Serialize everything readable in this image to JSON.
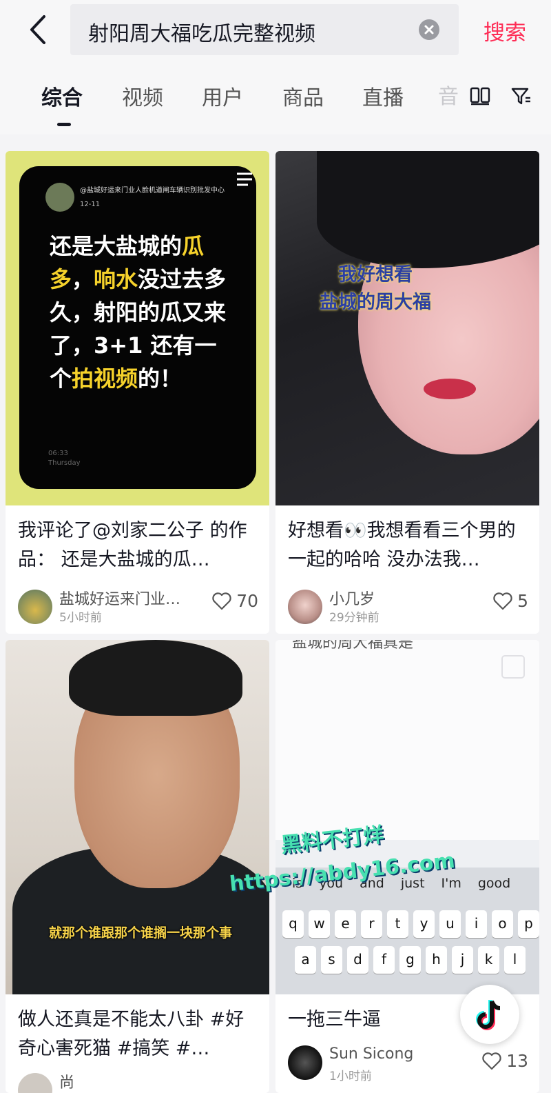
{
  "search": {
    "query": "射阳周大福吃瓜完整视频",
    "button": "搜索"
  },
  "tabs": [
    {
      "label": "综合"
    },
    {
      "label": "视频"
    },
    {
      "label": "用户"
    },
    {
      "label": "商品"
    },
    {
      "label": "直播"
    },
    {
      "label": "音"
    }
  ],
  "cards": [
    {
      "title": "我评论了@刘家二公子 的作品： 还是大盐城的瓜…",
      "author": "盐城好运来门业…",
      "time": "5小时前",
      "likes": "70",
      "art": {
        "handle": "@盐城好运来门业人脸机道闸车辆识别批发中心",
        "date": "12-11",
        "text_parts": [
          "还是大盐城的",
          "瓜",
          "多",
          "，",
          "响水",
          "没过去多久，射阳的瓜又来了，3+1 还有一个",
          "拍视频",
          "的！"
        ],
        "clock": "06:33",
        "day": "Thursday"
      }
    },
    {
      "title": "好想看👀我想看看三个男的一起的哈哈 没办法我…",
      "author": "小几岁",
      "time": "29分钟前",
      "likes": "5",
      "art": {
        "caption_line1": "我好想看",
        "caption_line2": "盐城的周大福"
      }
    },
    {
      "title": "做人还真是不能太八卦 #好奇心害死猫 #搞笑 #…",
      "author": "尚",
      "time": "",
      "likes": "",
      "art": {
        "caption": "就那个谁跟那个谁搁一块那个事"
      }
    },
    {
      "title": "一拖三牛逼",
      "author": "Sun Sicong",
      "time": "1小时前",
      "likes": "13",
      "art": {
        "top_text": "盐城的周大福真是",
        "suggestions": [
          "is",
          "you",
          "and",
          "just",
          "I'm",
          "good"
        ],
        "row1": [
          "q",
          "w",
          "e",
          "r",
          "t",
          "y",
          "u",
          "i",
          "o",
          "p"
        ],
        "row2": [
          "a",
          "s",
          "d",
          "f",
          "g",
          "h",
          "j",
          "k",
          "l"
        ]
      }
    }
  ],
  "watermark": {
    "line1": "黑料不打烊",
    "line2": "https://abdy16.com"
  },
  "colors": {
    "accent": "#fe2c55",
    "highlight": "#f6d22b"
  }
}
